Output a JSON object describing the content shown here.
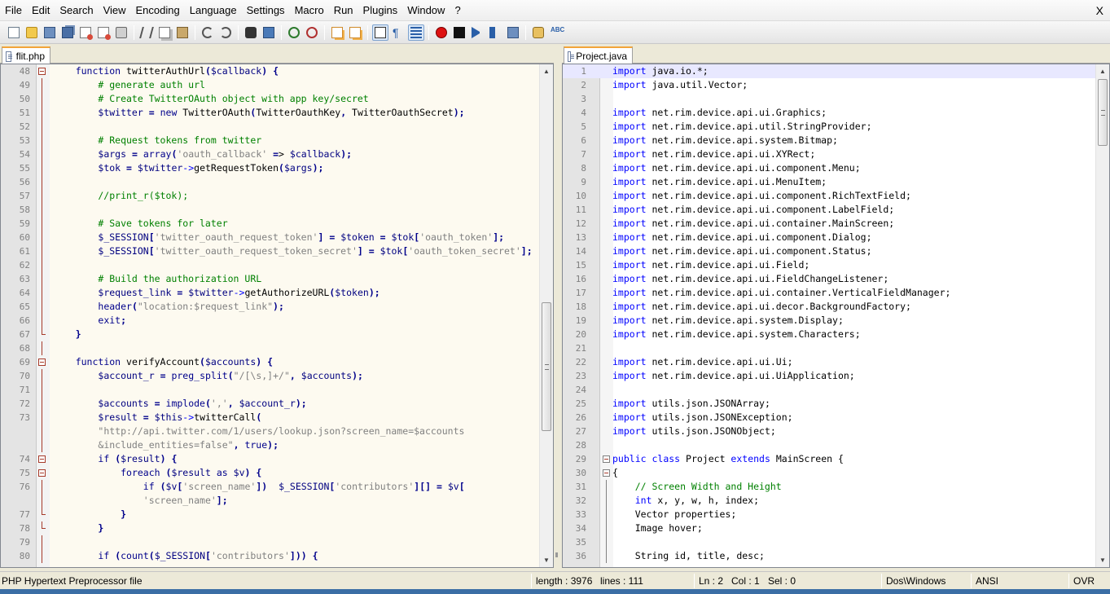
{
  "menu": [
    "File",
    "Edit",
    "Search",
    "View",
    "Encoding",
    "Language",
    "Settings",
    "Macro",
    "Run",
    "Plugins",
    "Window",
    "?"
  ],
  "window_close": "X",
  "toolbar_icons": [
    "new-file-icon",
    "open-file-icon",
    "save-icon",
    "save-all-icon",
    "close-icon",
    "close-all-icon",
    "print-icon",
    "cut-icon",
    "copy-icon",
    "paste-icon",
    "undo-icon",
    "redo-icon",
    "find-icon",
    "replace-icon",
    "zoom-in-icon",
    "zoom-out-icon",
    "sync-scroll-v-icon",
    "sync-scroll-h-icon",
    "word-wrap-icon",
    "show-all-chars-icon",
    "indent-guide-icon",
    "record-macro-icon",
    "stop-macro-icon",
    "play-macro-icon",
    "run-macro-multiple-icon",
    "save-macro-icon",
    "launch-browser-icon",
    "spell-check-icon"
  ],
  "left_tab": "flit.php",
  "right_tab": "Project.java",
  "left_lines": [
    {
      "n": "48",
      "t": "    function twitterAuthUrl($callback) {",
      "f": "open"
    },
    {
      "n": "49",
      "t": "        # generate auth url",
      "f": "line"
    },
    {
      "n": "50",
      "t": "        # Create TwitterOAuth object with app key/secret",
      "f": "line"
    },
    {
      "n": "51",
      "t": "        $twitter = new TwitterOAuth(TwitterOauthKey, TwitterOauthSecret);",
      "f": "line"
    },
    {
      "n": "52",
      "t": "",
      "f": "line"
    },
    {
      "n": "53",
      "t": "        # Request tokens from twitter",
      "f": "line"
    },
    {
      "n": "54",
      "t": "        $args = array('oauth_callback' => $callback);",
      "f": "line"
    },
    {
      "n": "55",
      "t": "        $tok = $twitter->getRequestToken($args);",
      "f": "line"
    },
    {
      "n": "56",
      "t": "",
      "f": "line"
    },
    {
      "n": "57",
      "t": "        //print_r($tok);",
      "f": "line"
    },
    {
      "n": "58",
      "t": "",
      "f": "line"
    },
    {
      "n": "59",
      "t": "        # Save tokens for later",
      "f": "line"
    },
    {
      "n": "60",
      "t": "        $_SESSION['twitter_oauth_request_token'] = $token = $tok['oauth_token'];",
      "f": "line"
    },
    {
      "n": "61",
      "t": "        $_SESSION['twitter_oauth_request_token_secret'] = $tok['oauth_token_secret'];",
      "f": "line"
    },
    {
      "n": "62",
      "t": "",
      "f": "line"
    },
    {
      "n": "63",
      "t": "        # Build the authorization URL",
      "f": "line"
    },
    {
      "n": "64",
      "t": "        $request_link = $twitter->getAuthorizeURL($token);",
      "f": "line"
    },
    {
      "n": "65",
      "t": "        header(\"location:$request_link\");",
      "f": "line"
    },
    {
      "n": "66",
      "t": "        exit;",
      "f": "line"
    },
    {
      "n": "67",
      "t": "    }",
      "f": "end"
    },
    {
      "n": "68",
      "t": "",
      "f": "line"
    },
    {
      "n": "69",
      "t": "    function verifyAccount($accounts) {",
      "f": "open"
    },
    {
      "n": "70",
      "t": "        $account_r = preg_split(\"/[\\s,]+/\", $accounts);",
      "f": "line"
    },
    {
      "n": "71",
      "t": "",
      "f": "line"
    },
    {
      "n": "72",
      "t": "        $accounts = implode(',', $account_r);",
      "f": "line"
    },
    {
      "n": "73",
      "t": "        $result = $this->twitterCall(",
      "f": "line"
    },
    {
      "n": "",
      "t": "        \"http://api.twitter.com/1/users/lookup.json?screen_name=$accounts",
      "f": "line"
    },
    {
      "n": "",
      "t": "        &include_entities=false\", true);",
      "f": "line"
    },
    {
      "n": "74",
      "t": "        if ($result) {",
      "f": "open"
    },
    {
      "n": "75",
      "t": "            foreach ($result as $v) {",
      "f": "open"
    },
    {
      "n": "76",
      "t": "                if ($v['screen_name'])  $_SESSION['contributors'][] = $v[",
      "f": "line"
    },
    {
      "n": "",
      "t": "                'screen_name'];",
      "f": "line"
    },
    {
      "n": "77",
      "t": "            }",
      "f": "end"
    },
    {
      "n": "78",
      "t": "        }",
      "f": "end"
    },
    {
      "n": "79",
      "t": "",
      "f": "line"
    },
    {
      "n": "80",
      "t": "        if (count($_SESSION['contributors'])) {",
      "f": "line"
    }
  ],
  "right_lines": [
    {
      "n": "1",
      "t": "import java.io.*;",
      "f": ""
    },
    {
      "n": "2",
      "t": "import java.util.Vector;",
      "f": ""
    },
    {
      "n": "3",
      "t": "",
      "f": ""
    },
    {
      "n": "4",
      "t": "import net.rim.device.api.ui.Graphics;",
      "f": ""
    },
    {
      "n": "5",
      "t": "import net.rim.device.api.util.StringProvider;",
      "f": ""
    },
    {
      "n": "6",
      "t": "import net.rim.device.api.system.Bitmap;",
      "f": ""
    },
    {
      "n": "7",
      "t": "import net.rim.device.api.ui.XYRect;",
      "f": ""
    },
    {
      "n": "8",
      "t": "import net.rim.device.api.ui.component.Menu;",
      "f": ""
    },
    {
      "n": "9",
      "t": "import net.rim.device.api.ui.MenuItem;",
      "f": ""
    },
    {
      "n": "10",
      "t": "import net.rim.device.api.ui.component.RichTextField;",
      "f": ""
    },
    {
      "n": "11",
      "t": "import net.rim.device.api.ui.component.LabelField;",
      "f": ""
    },
    {
      "n": "12",
      "t": "import net.rim.device.api.ui.container.MainScreen;",
      "f": ""
    },
    {
      "n": "13",
      "t": "import net.rim.device.api.ui.component.Dialog;",
      "f": ""
    },
    {
      "n": "14",
      "t": "import net.rim.device.api.ui.component.Status;",
      "f": ""
    },
    {
      "n": "15",
      "t": "import net.rim.device.api.ui.Field;",
      "f": ""
    },
    {
      "n": "16",
      "t": "import net.rim.device.api.ui.FieldChangeListener;",
      "f": ""
    },
    {
      "n": "17",
      "t": "import net.rim.device.api.ui.container.VerticalFieldManager;",
      "f": ""
    },
    {
      "n": "18",
      "t": "import net.rim.device.api.ui.decor.BackgroundFactory;",
      "f": ""
    },
    {
      "n": "19",
      "t": "import net.rim.device.api.system.Display;",
      "f": ""
    },
    {
      "n": "20",
      "t": "import net.rim.device.api.system.Characters;",
      "f": ""
    },
    {
      "n": "21",
      "t": "",
      "f": ""
    },
    {
      "n": "22",
      "t": "import net.rim.device.api.ui.Ui;",
      "f": ""
    },
    {
      "n": "23",
      "t": "import net.rim.device.api.ui.UiApplication;",
      "f": ""
    },
    {
      "n": "24",
      "t": "",
      "f": ""
    },
    {
      "n": "25",
      "t": "import utils.json.JSONArray;",
      "f": ""
    },
    {
      "n": "26",
      "t": "import utils.json.JSONException;",
      "f": ""
    },
    {
      "n": "27",
      "t": "import utils.json.JSONObject;",
      "f": ""
    },
    {
      "n": "28",
      "t": "",
      "f": ""
    },
    {
      "n": "29",
      "t": "public class Project extends MainScreen {",
      "f": "openj"
    },
    {
      "n": "30",
      "t": "{",
      "f": "openj"
    },
    {
      "n": "31",
      "t": "    // Screen Width and Height",
      "f": "linej"
    },
    {
      "n": "32",
      "t": "    int x, y, w, h, index;",
      "f": "linej"
    },
    {
      "n": "33",
      "t": "    Vector properties;",
      "f": "linej"
    },
    {
      "n": "34",
      "t": "    Image hover;",
      "f": "linej"
    },
    {
      "n": "35",
      "t": "",
      "f": "linej"
    },
    {
      "n": "36",
      "t": "    String id, title, desc;",
      "f": "linej"
    }
  ],
  "status": {
    "filetype": "PHP Hypertext Preprocessor file",
    "length": "length : 3976",
    "lines": "lines : 111",
    "ln": "Ln : 2",
    "col": "Col : 1",
    "sel": "Sel : 0",
    "eol": "Dos\\Windows",
    "encoding": "ANSI",
    "mode": "OVR"
  },
  "colors": {
    "left_bg": "#fdfaf0",
    "right_bg": "#ffffff",
    "current_line": "#e8e8ff",
    "tab_accent": "#f2a43a",
    "fold_marker": "#a63a2a",
    "fold_marker_java": "#808080"
  }
}
